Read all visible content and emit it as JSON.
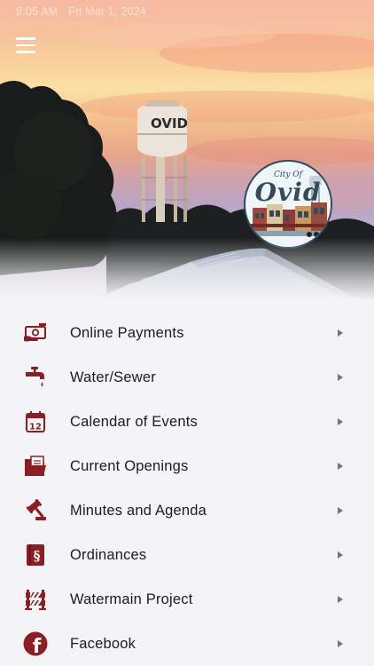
{
  "status_bar": {
    "time": "8:05 AM",
    "date": "Fri Mar 1, 2024"
  },
  "hero": {
    "water_tower_text": "OVID",
    "logo": {
      "line1": "City Of",
      "line2": "Ovid"
    }
  },
  "menu": {
    "items": [
      {
        "label": "Online Payments",
        "icon": "payment-icon"
      },
      {
        "label": "Water/Sewer",
        "icon": "faucet-icon"
      },
      {
        "label": "Calendar of Events",
        "icon": "calendar-icon",
        "icon_text": "12"
      },
      {
        "label": "Current Openings",
        "icon": "folder-icon"
      },
      {
        "label": "Minutes and Agenda",
        "icon": "gavel-icon"
      },
      {
        "label": "Ordinances",
        "icon": "ordinance-book-icon",
        "icon_text": "§"
      },
      {
        "label": "Watermain Project",
        "icon": "construction-barrier-icon"
      },
      {
        "label": "Facebook",
        "icon": "facebook-icon",
        "icon_text": "f"
      }
    ]
  },
  "colors": {
    "icon": "#8b1e24",
    "chevron": "#757575",
    "text": "#1c1c1e",
    "background": "#f4f4f6"
  }
}
